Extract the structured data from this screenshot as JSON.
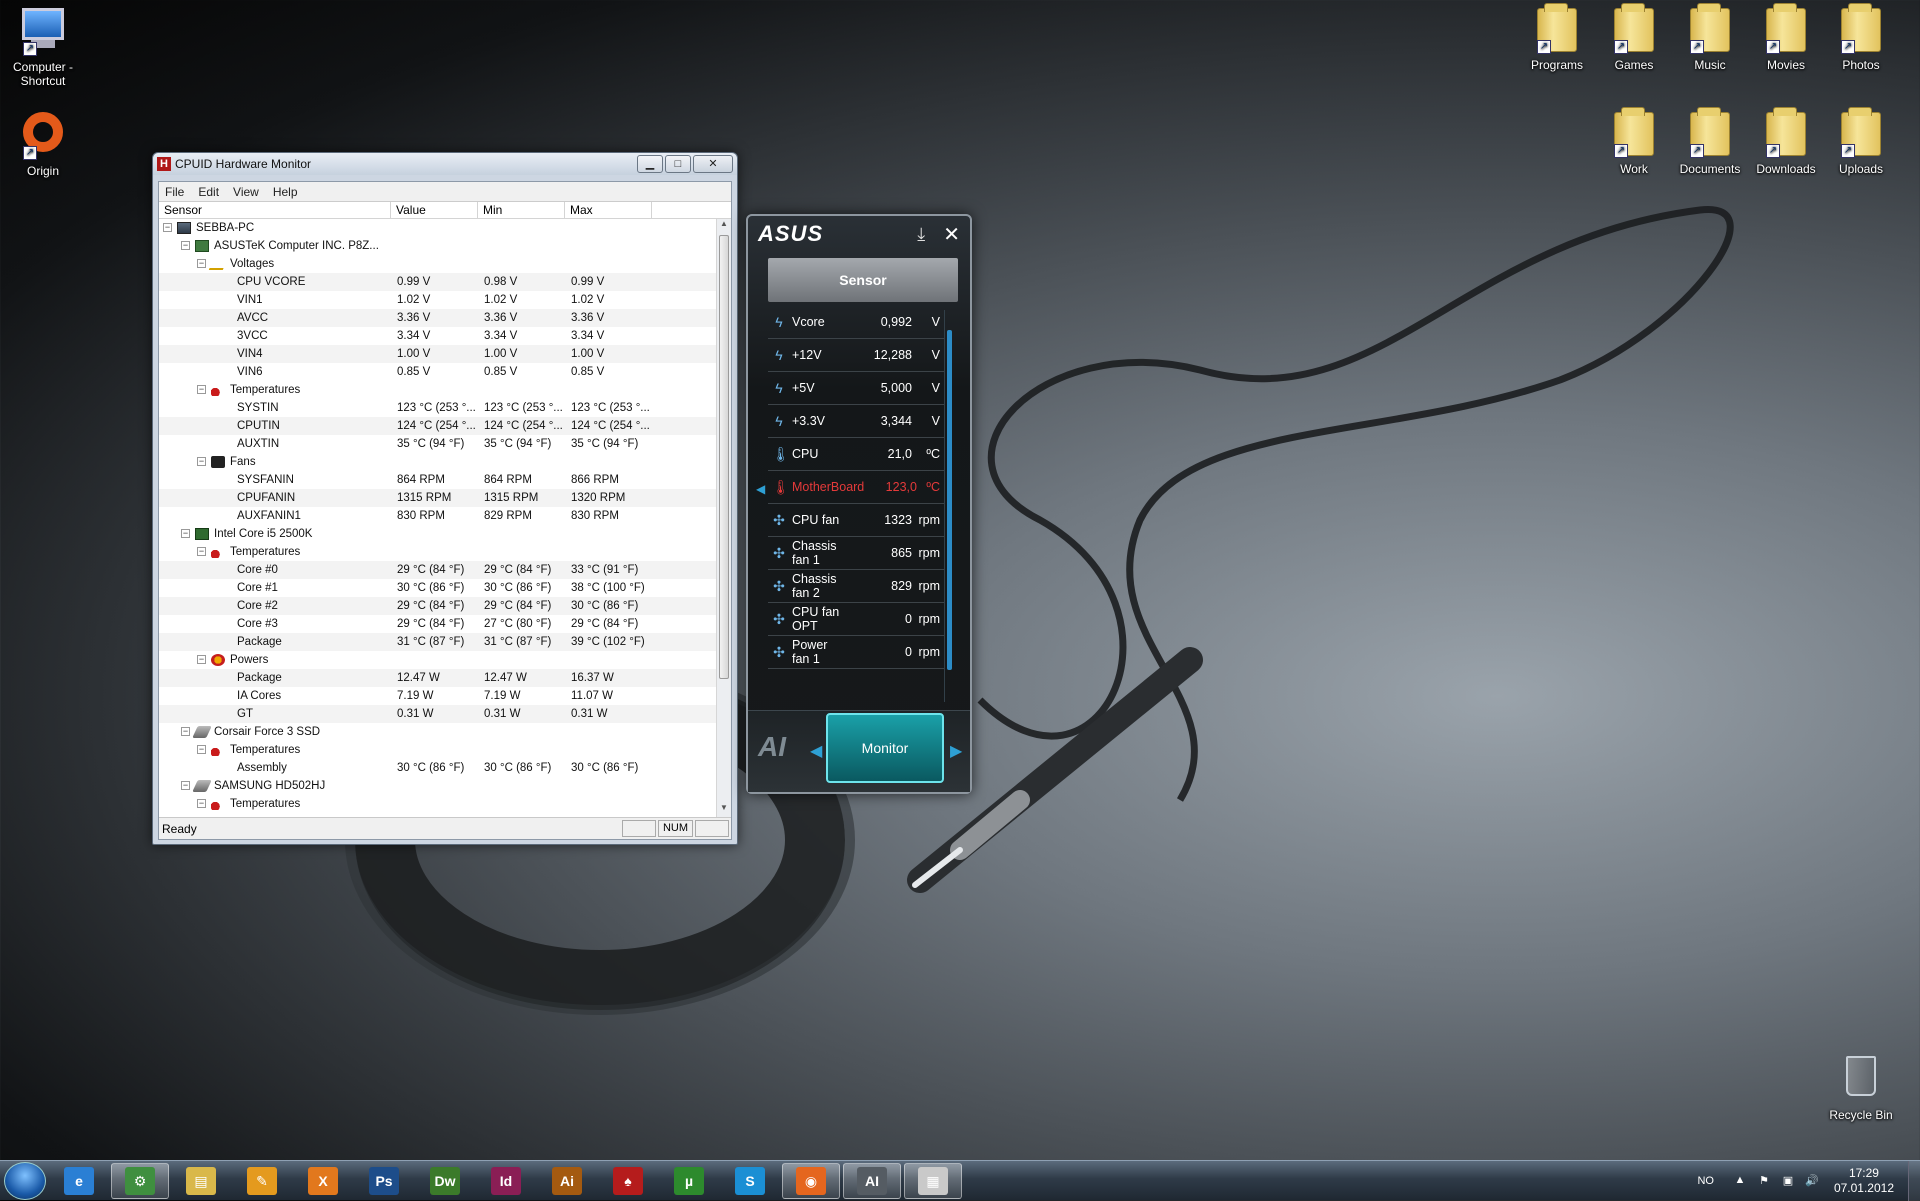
{
  "desktop": {
    "left_icons": [
      {
        "label": "Computer - Shortcut",
        "icon": "computer-icon"
      },
      {
        "label": "Origin",
        "icon": "origin-icon"
      }
    ],
    "right_icons_row1": [
      {
        "label": "Programs",
        "icon": "folder-icon"
      },
      {
        "label": "Games",
        "icon": "folder-icon"
      },
      {
        "label": "Music",
        "icon": "folder-icon"
      },
      {
        "label": "Movies",
        "icon": "folder-icon"
      },
      {
        "label": "Photos",
        "icon": "folder-icon"
      }
    ],
    "right_icons_row2": [
      {
        "label": "Work",
        "icon": "folder-icon"
      },
      {
        "label": "Documents",
        "icon": "folder-icon"
      },
      {
        "label": "Downloads",
        "icon": "folder-icon"
      },
      {
        "label": "Uploads",
        "icon": "folder-icon"
      }
    ],
    "recycle_bin": {
      "label": "Recycle Bin",
      "icon": "recycle-bin-icon"
    }
  },
  "hwmonitor": {
    "title": "CPUID Hardware Monitor",
    "app_icon": "H",
    "controls": {
      "minimize": "▁",
      "maximize": "□",
      "close": "✕"
    },
    "menu": [
      "File",
      "Edit",
      "View",
      "Help"
    ],
    "columns": [
      "Sensor",
      "Value",
      "Min",
      "Max"
    ],
    "rows": [
      {
        "level": 0,
        "toggle": "−",
        "icon": "pc",
        "name": "SEBBA-PC",
        "value": "",
        "min": "",
        "max": ""
      },
      {
        "level": 1,
        "toggle": "−",
        "icon": "mb",
        "name": "ASUSTeK Computer INC. P8Z...",
        "value": "",
        "min": "",
        "max": ""
      },
      {
        "level": 2,
        "toggle": "−",
        "icon": "volt",
        "name": "Voltages",
        "value": "",
        "min": "",
        "max": ""
      },
      {
        "level": 3,
        "name": "CPU VCORE",
        "value": "0.99 V",
        "min": "0.98 V",
        "max": "0.99 V"
      },
      {
        "level": 3,
        "name": "VIN1",
        "value": "1.02 V",
        "min": "1.02 V",
        "max": "1.02 V"
      },
      {
        "level": 3,
        "name": "AVCC",
        "value": "3.36 V",
        "min": "3.36 V",
        "max": "3.36 V"
      },
      {
        "level": 3,
        "name": "3VCC",
        "value": "3.34 V",
        "min": "3.34 V",
        "max": "3.34 V"
      },
      {
        "level": 3,
        "name": "VIN4",
        "value": "1.00 V",
        "min": "1.00 V",
        "max": "1.00 V"
      },
      {
        "level": 3,
        "name": "VIN6",
        "value": "0.85 V",
        "min": "0.85 V",
        "max": "0.85 V"
      },
      {
        "level": 2,
        "toggle": "−",
        "icon": "temp",
        "name": "Temperatures",
        "value": "",
        "min": "",
        "max": ""
      },
      {
        "level": 3,
        "name": "SYSTIN",
        "value": "123 °C (253 °...",
        "min": "123 °C (253 °...",
        "max": "123 °C (253 °..."
      },
      {
        "level": 3,
        "name": "CPUTIN",
        "value": "124 °C (254 °...",
        "min": "124 °C (254 °...",
        "max": "124 °C (254 °..."
      },
      {
        "level": 3,
        "name": "AUXTIN",
        "value": "35 °C (94 °F)",
        "min": "35 °C (94 °F)",
        "max": "35 °C (94 °F)"
      },
      {
        "level": 2,
        "toggle": "−",
        "icon": "fan",
        "name": "Fans",
        "value": "",
        "min": "",
        "max": ""
      },
      {
        "level": 3,
        "name": "SYSFANIN",
        "value": "864 RPM",
        "min": "864 RPM",
        "max": "866 RPM"
      },
      {
        "level": 3,
        "name": "CPUFANIN",
        "value": "1315 RPM",
        "min": "1315 RPM",
        "max": "1320 RPM"
      },
      {
        "level": 3,
        "name": "AUXFANIN1",
        "value": "830 RPM",
        "min": "829 RPM",
        "max": "830 RPM"
      },
      {
        "level": 1,
        "toggle": "−",
        "icon": "cpu",
        "name": "Intel Core i5 2500K",
        "value": "",
        "min": "",
        "max": ""
      },
      {
        "level": 2,
        "toggle": "−",
        "icon": "temp",
        "name": "Temperatures",
        "value": "",
        "min": "",
        "max": ""
      },
      {
        "level": 3,
        "name": "Core #0",
        "value": "29 °C (84 °F)",
        "min": "29 °C (84 °F)",
        "max": "33 °C (91 °F)"
      },
      {
        "level": 3,
        "name": "Core #1",
        "value": "30 °C (86 °F)",
        "min": "30 °C (86 °F)",
        "max": "38 °C (100 °F)"
      },
      {
        "level": 3,
        "name": "Core #2",
        "value": "29 °C (84 °F)",
        "min": "29 °C (84 °F)",
        "max": "30 °C (86 °F)"
      },
      {
        "level": 3,
        "name": "Core #3",
        "value": "29 °C (84 °F)",
        "min": "27 °C (80 °F)",
        "max": "29 °C (84 °F)"
      },
      {
        "level": 3,
        "name": "Package",
        "value": "31 °C (87 °F)",
        "min": "31 °C (87 °F)",
        "max": "39 °C (102 °F)"
      },
      {
        "level": 2,
        "toggle": "−",
        "icon": "pow",
        "name": "Powers",
        "value": "",
        "min": "",
        "max": ""
      },
      {
        "level": 3,
        "name": "Package",
        "value": "12.47 W",
        "min": "12.47 W",
        "max": "16.37 W"
      },
      {
        "level": 3,
        "name": "IA Cores",
        "value": "7.19 W",
        "min": "7.19 W",
        "max": "11.07 W"
      },
      {
        "level": 3,
        "name": "GT",
        "value": "0.31 W",
        "min": "0.31 W",
        "max": "0.31 W"
      },
      {
        "level": 1,
        "toggle": "−",
        "icon": "disk",
        "name": "Corsair Force 3 SSD",
        "value": "",
        "min": "",
        "max": ""
      },
      {
        "level": 2,
        "toggle": "−",
        "icon": "temp",
        "name": "Temperatures",
        "value": "",
        "min": "",
        "max": ""
      },
      {
        "level": 3,
        "name": "Assembly",
        "value": "30 °C (86 °F)",
        "min": "30 °C (86 °F)",
        "max": "30 °C (86 °F)"
      },
      {
        "level": 1,
        "toggle": "−",
        "icon": "disk",
        "name": "SAMSUNG HD502HJ",
        "value": "",
        "min": "",
        "max": ""
      },
      {
        "level": 2,
        "toggle": "−",
        "icon": "temp",
        "name": "Temperatures",
        "value": "",
        "min": "",
        "max": ""
      }
    ],
    "status": {
      "ready": "Ready",
      "num": "NUM"
    }
  },
  "asus": {
    "logo": "ASUS",
    "download_icon": "download-icon",
    "close_label": "✕",
    "tab": "Sensor",
    "sensors": [
      {
        "icon": "bolt-icon",
        "glyph": "ϟ",
        "name": "Vcore",
        "value": "0,992",
        "unit": "V",
        "warn": false
      },
      {
        "icon": "bolt-icon",
        "glyph": "ϟ",
        "name": "+12V",
        "value": "12,288",
        "unit": "V",
        "warn": false
      },
      {
        "icon": "bolt-icon",
        "glyph": "ϟ",
        "name": "+5V",
        "value": "5,000",
        "unit": "V",
        "warn": false
      },
      {
        "icon": "bolt-icon",
        "glyph": "ϟ",
        "name": "+3.3V",
        "value": "3,344",
        "unit": "V",
        "warn": false
      },
      {
        "icon": "thermometer-icon",
        "glyph": "🌡",
        "name": "CPU",
        "value": "21,0",
        "unit": "ºC",
        "warn": false
      },
      {
        "icon": "thermometer-icon",
        "glyph": "🌡",
        "name": "MotherBoard",
        "value": "123,0",
        "unit": "ºC",
        "warn": true
      },
      {
        "icon": "fan-icon",
        "glyph": "✣",
        "name": "CPU fan",
        "value": "1323",
        "unit": "rpm",
        "warn": false
      },
      {
        "icon": "fan-icon",
        "glyph": "✣",
        "name": "Chassis fan 1",
        "value": "865",
        "unit": "rpm",
        "warn": false
      },
      {
        "icon": "fan-icon",
        "glyph": "✣",
        "name": "Chassis fan 2",
        "value": "829",
        "unit": "rpm",
        "warn": false
      },
      {
        "icon": "fan-icon",
        "glyph": "✣",
        "name": "CPU fan OPT",
        "value": "0",
        "unit": "rpm",
        "warn": false
      },
      {
        "icon": "fan-icon",
        "glyph": "✣",
        "name": "Power fan 1",
        "value": "0",
        "unit": "rpm",
        "warn": false
      }
    ],
    "ai_logo": "AI",
    "monitor_button": "Monitor"
  },
  "taskbar": {
    "items": [
      {
        "name": "ie",
        "label": "e",
        "color": "#2a7fd4",
        "active": false
      },
      {
        "name": "network",
        "label": "⚙",
        "color": "#3f8f3f",
        "active": true
      },
      {
        "name": "explorer",
        "label": "▤",
        "color": "#d9b84a",
        "active": false
      },
      {
        "name": "pencil",
        "label": "✎",
        "color": "#e49a1e",
        "active": false
      },
      {
        "name": "xchat",
        "label": "X",
        "color": "#e2781d",
        "active": false
      },
      {
        "name": "photoshop",
        "label": "Ps",
        "color": "#1d4d8a",
        "active": false
      },
      {
        "name": "dreamweaver",
        "label": "Dw",
        "color": "#3b7a2a",
        "active": false
      },
      {
        "name": "indesign",
        "label": "Id",
        "color": "#8a1e55",
        "active": false
      },
      {
        "name": "illustrator",
        "label": "Ai",
        "color": "#a45a10",
        "active": false
      },
      {
        "name": "pokerstars",
        "label": "♠",
        "color": "#b51c1c",
        "active": false
      },
      {
        "name": "utorrent",
        "label": "µ",
        "color": "#2d8a2d",
        "active": false
      },
      {
        "name": "skype",
        "label": "S",
        "color": "#1b8fd4",
        "active": false
      },
      {
        "name": "origin",
        "label": "◉",
        "color": "#e5661e",
        "active": true
      },
      {
        "name": "asus-ai",
        "label": "AI",
        "color": "#555c63",
        "active": true
      },
      {
        "name": "hwmonitor",
        "label": "▦",
        "color": "#c9c9c9",
        "active": true
      }
    ],
    "lang": "NO",
    "tray_icons": [
      "▲",
      "⚑",
      "▣",
      "🔊"
    ],
    "time": "17:29",
    "date": "07.01.2012"
  }
}
